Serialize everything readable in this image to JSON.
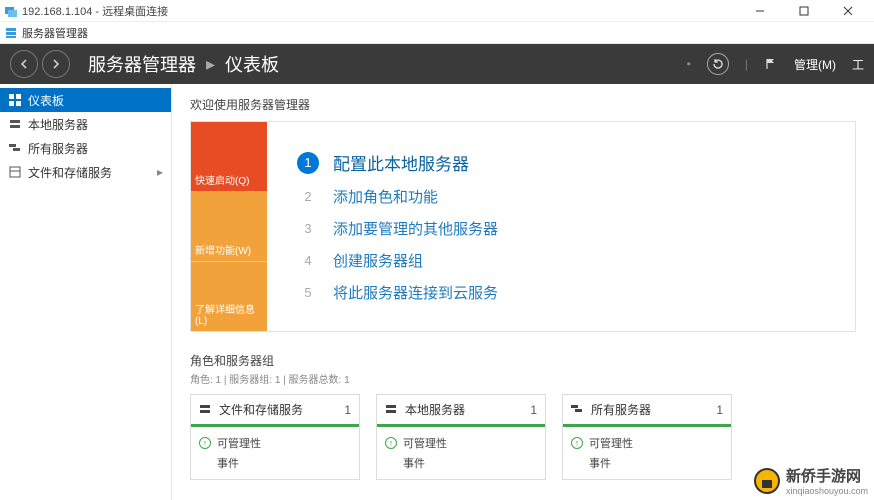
{
  "window": {
    "title": "192.168.1.104 - 远程桌面连接"
  },
  "menubar": {
    "label": "服务器管理器"
  },
  "header": {
    "crumb1": "服务器管理器",
    "crumb2": "仪表板",
    "menu_manage": "管理(M)",
    "menu_tools": "工"
  },
  "sidebar": {
    "items": [
      {
        "label": "仪表板"
      },
      {
        "label": "本地服务器"
      },
      {
        "label": "所有服务器"
      },
      {
        "label": "文件和存储服务"
      }
    ]
  },
  "welcome": {
    "heading": "欢迎使用服务器管理器",
    "tabs": [
      {
        "label": "快速启动(Q)"
      },
      {
        "label": "新增功能(W)"
      },
      {
        "label": "了解详细信息(L)"
      }
    ],
    "steps": [
      {
        "n": "1",
        "label": "配置此本地服务器"
      },
      {
        "n": "2",
        "label": "添加角色和功能"
      },
      {
        "n": "3",
        "label": "添加要管理的其他服务器"
      },
      {
        "n": "4",
        "label": "创建服务器组"
      },
      {
        "n": "5",
        "label": "将此服务器连接到云服务"
      }
    ]
  },
  "roles": {
    "title": "角色和服务器组",
    "subtitle": "角色: 1 | 服务器组: 1 | 服务器总数: 1",
    "tiles": [
      {
        "title": "文件和存储服务",
        "count": "1",
        "row1": "可管理性",
        "row2": "事件"
      },
      {
        "title": "本地服务器",
        "count": "1",
        "row1": "可管理性",
        "row2": "事件"
      },
      {
        "title": "所有服务器",
        "count": "1",
        "row1": "可管理性",
        "row2": "事件"
      }
    ]
  },
  "watermark": {
    "name": "新侨手游网",
    "url": "xinqiaoshouyou.com"
  }
}
